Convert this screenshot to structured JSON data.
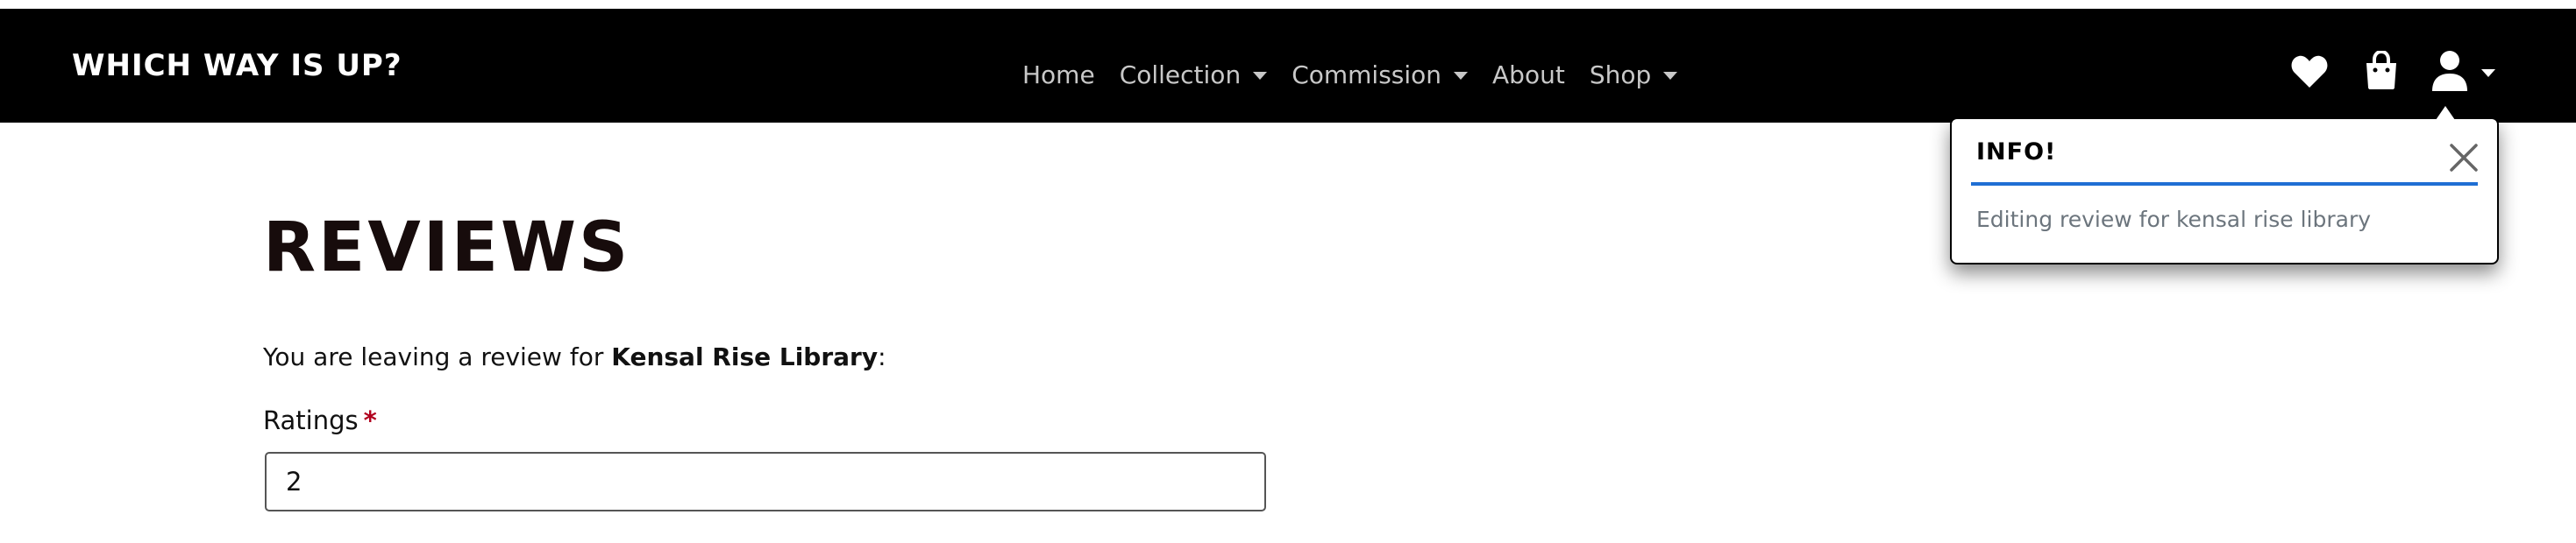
{
  "header": {
    "brand": "WHICH WAY IS UP?",
    "nav": [
      {
        "label": "Home",
        "dropdown": false
      },
      {
        "label": "Collection",
        "dropdown": true
      },
      {
        "label": "Commission",
        "dropdown": true
      },
      {
        "label": "About",
        "dropdown": false
      },
      {
        "label": "Shop",
        "dropdown": true
      }
    ],
    "icons": [
      "heart-icon",
      "shopping-bag-icon",
      "user-icon"
    ]
  },
  "toast": {
    "title": "INFO!",
    "message": "Editing review for kensal rise library",
    "accent_color": "#1f6fd4"
  },
  "main": {
    "title": "REVIEWS",
    "intro_prefix": "You are leaving a review for ",
    "intro_subject": "Kensal Rise Library",
    "intro_suffix": ":",
    "ratings_label": "Ratings",
    "required_marker": "*",
    "ratings_value": "2"
  },
  "colors": {
    "header_bg": "#000000",
    "required": "#b1001e",
    "nav_text": "#c8c8c8"
  }
}
